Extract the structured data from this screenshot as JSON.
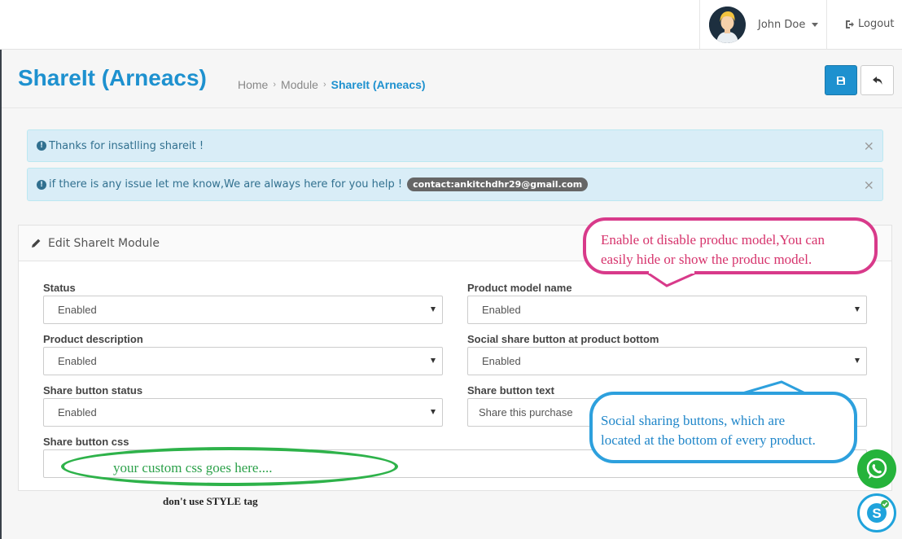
{
  "header": {
    "user_name": "John Doe",
    "logout_label": "Logout"
  },
  "page": {
    "title": "ShareIt (Arneacs)",
    "breadcrumb": [
      "Home",
      "Module",
      "ShareIt (Arneacs)"
    ]
  },
  "alerts": [
    {
      "text": "Thanks for insatlling shareit !"
    },
    {
      "text": "if there is any issue let me know,We are always here for you help !",
      "badge": "contact:ankitchdhr29@gmail.com"
    }
  ],
  "panel": {
    "title": "Edit ShareIt Module",
    "fields": {
      "status": {
        "label": "Status",
        "value": "Enabled"
      },
      "product_model_name": {
        "label": "Product model name",
        "value": "Enabled"
      },
      "product_description": {
        "label": "Product description",
        "value": "Enabled"
      },
      "social_share_bottom": {
        "label": "Social share button at product bottom",
        "value": "Enabled"
      },
      "share_button_status": {
        "label": "Share button status",
        "value": "Enabled"
      },
      "share_button_text": {
        "label": "Share button text",
        "value": "Share this purchase"
      },
      "share_button_css": {
        "label": "Share button css",
        "value": ""
      }
    }
  },
  "annotations": {
    "pink_line1": "Enable ot disable produc model,You can",
    "pink_line2": "easily hide or show the produc model.",
    "blue_line1": "Social sharing buttons, which are",
    "blue_line2": "located at the bottom of every product.",
    "green": "your custom css goes here....",
    "note": "don't use STYLE tag"
  },
  "colors": {
    "accent": "#1e91cf",
    "pink": "#d83a8a",
    "blue": "#2da0dd",
    "green": "#2eb24a"
  }
}
